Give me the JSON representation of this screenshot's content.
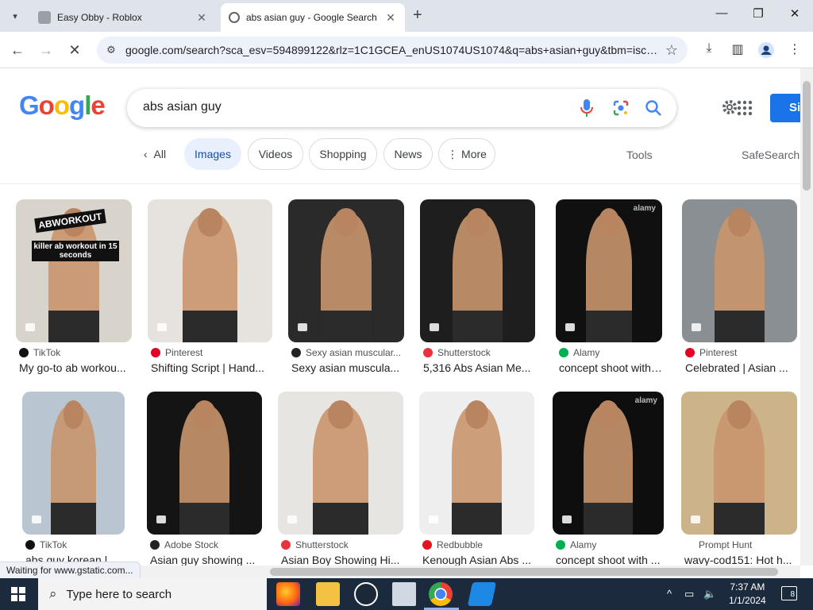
{
  "browser": {
    "tabs": [
      {
        "title": "Easy Obby - Roblox",
        "active": false
      },
      {
        "title": "abs asian guy - Google Search",
        "active": true
      }
    ],
    "url": "google.com/search?sca_esv=594899122&rlz=1C1GCEA_enUS1074US1074&q=abs+asian+guy&tbm=isch&...",
    "status": "Waiting for www.gstatic.com..."
  },
  "google": {
    "query": "abs asian guy",
    "signin_label": "Si",
    "tabs": {
      "all": "All",
      "images": "Images",
      "videos": "Videos",
      "shopping": "Shopping",
      "news": "News",
      "more": "More"
    },
    "tools": "Tools",
    "safesearch": "SafeSearch"
  },
  "results": [
    {
      "source": "TikTok",
      "title": "My go-to ab workou...",
      "icon_color": "#111111",
      "bg": "#d8d4cc",
      "overlay_text": "ABWORKOUT",
      "overlay_sub": "killer ab workout in 15 seconds"
    },
    {
      "source": "Pinterest",
      "title": "Shifting Script | Hand...",
      "icon_color": "#e60023",
      "bg": "#e6e3de"
    },
    {
      "source": "Sexy asian muscular...",
      "title": "Sexy asian muscula...",
      "icon_color": "#222222",
      "bg": "#2a2a2a"
    },
    {
      "source": "Shutterstock",
      "title": "5,316 Abs Asian Me...",
      "icon_color": "#e8333c",
      "bg": "#1e1e1e"
    },
    {
      "source": "Alamy",
      "title": "concept shoot with ...",
      "icon_color": "#00b050",
      "bg": "#101010",
      "watermark": "alamy"
    },
    {
      "source": "Pinterest",
      "title": "Celebrated | Asian ...",
      "icon_color": "#e60023",
      "bg": "#8a8f93"
    },
    {
      "source": "TikTok",
      "title": "abs guy korean | Ti...",
      "icon_color": "#111111",
      "bg": "#b9c6d2"
    },
    {
      "source": "Adobe Stock",
      "title": "Asian guy showing ...",
      "icon_color": "#222222",
      "bg": "#141414"
    },
    {
      "source": "Shutterstock",
      "title": "Asian Boy Showing Hi...",
      "icon_color": "#e8333c",
      "bg": "#e7e5e2"
    },
    {
      "source": "Redbubble",
      "title": "Kenough Asian Abs ...",
      "icon_color": "#e41321",
      "bg": "#eeeeee"
    },
    {
      "source": "Alamy",
      "title": "concept shoot with ...",
      "icon_color": "#00b050",
      "bg": "#0e0e0e",
      "watermark": "alamy"
    },
    {
      "source": "Prompt Hunt",
      "title": "wavy-cod151: Hot h...",
      "icon_color": "#ffffff",
      "bg": "#cdb38a"
    }
  ],
  "taskbar": {
    "search_placeholder": "Type here to search",
    "time": "7:37 AM",
    "date": "1/1/2024",
    "notifications": "8"
  }
}
